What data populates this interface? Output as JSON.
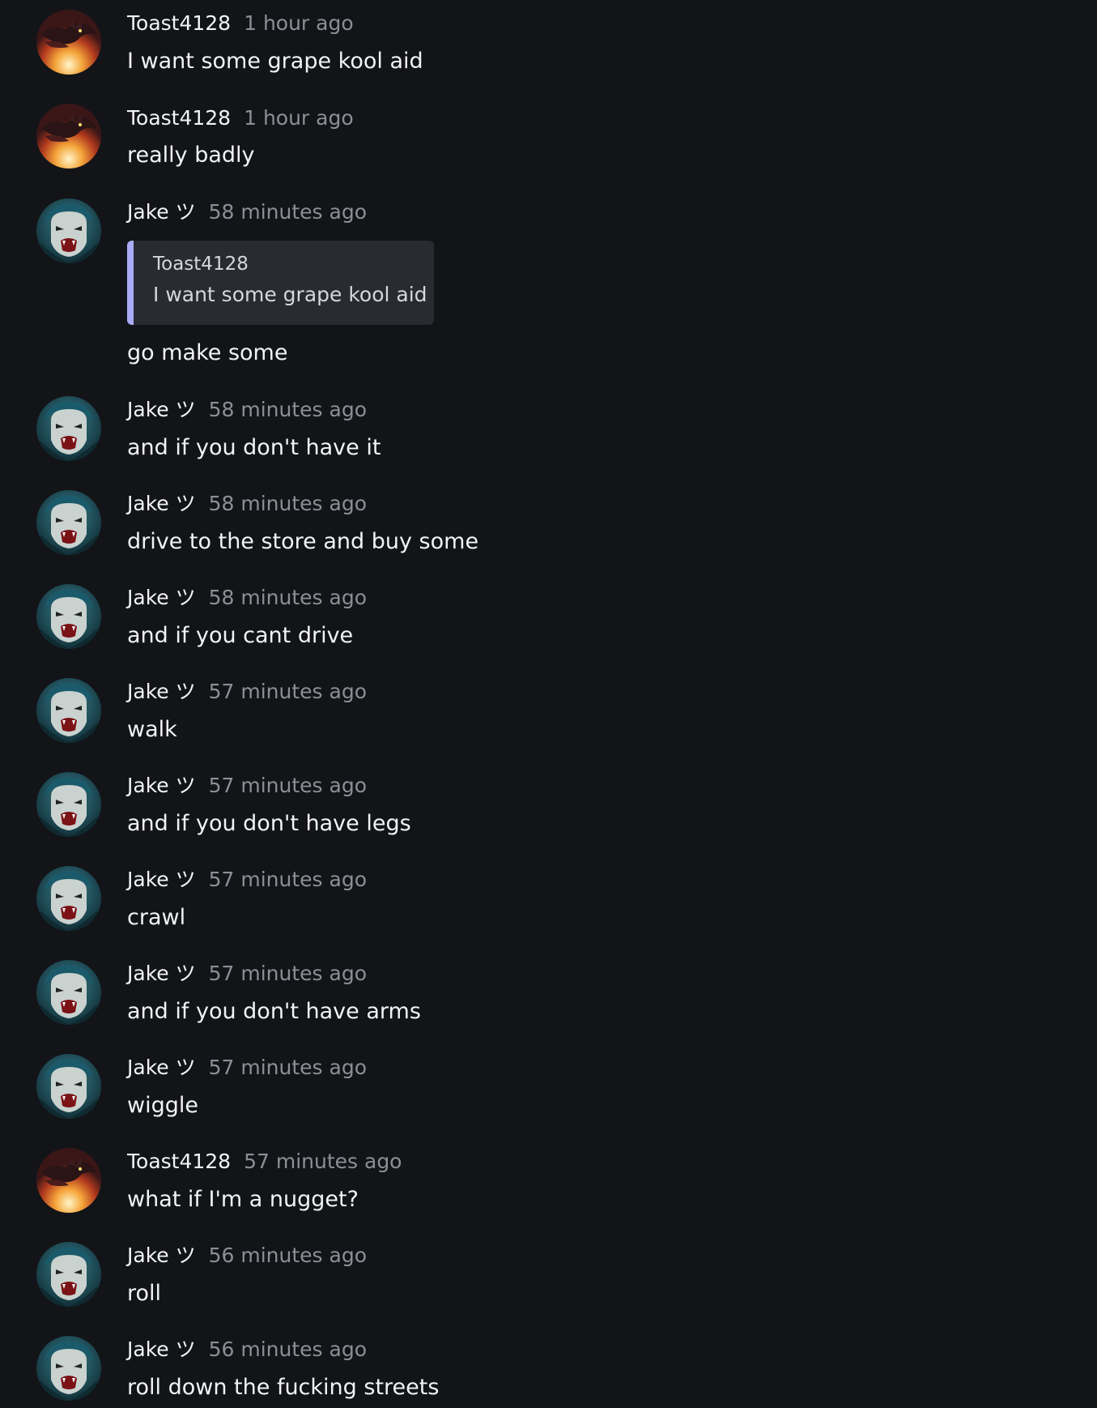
{
  "colors": {
    "background": "#131418",
    "text": "#f2f3f5",
    "timestamp": "#8d8f96",
    "quote_background": "#2a2b30",
    "quote_accent": "#a9abf5"
  },
  "users": {
    "toast": {
      "name": "Toast4128",
      "avatar": "dragon-flame-avatar"
    },
    "jake": {
      "name": "Jake ツ",
      "avatar": "vampire-face-avatar"
    }
  },
  "messages": [
    {
      "author": "Toast4128",
      "time": "1 hour ago",
      "text": "I want some grape kool aid"
    },
    {
      "author": "Toast4128",
      "time": "1 hour ago",
      "text": "really badly"
    },
    {
      "author": "Jake ツ",
      "time": "58 minutes ago",
      "quote": {
        "author": "Toast4128",
        "text": "I want some grape kool aid"
      },
      "text": "go make some"
    },
    {
      "author": "Jake ツ",
      "time": "58 minutes ago",
      "text": "and if you don't have it"
    },
    {
      "author": "Jake ツ",
      "time": "58 minutes ago",
      "text": "drive to the store and buy some"
    },
    {
      "author": "Jake ツ",
      "time": "58 minutes ago",
      "text": "and if you cant drive"
    },
    {
      "author": "Jake ツ",
      "time": "57 minutes ago",
      "text": "walk"
    },
    {
      "author": "Jake ツ",
      "time": "57 minutes ago",
      "text": "and if you don't have legs"
    },
    {
      "author": "Jake ツ",
      "time": "57 minutes ago",
      "text": "crawl"
    },
    {
      "author": "Jake ツ",
      "time": "57 minutes ago",
      "text": "and if you don't have arms"
    },
    {
      "author": "Jake ツ",
      "time": "57 minutes ago",
      "text": "wiggle"
    },
    {
      "author": "Toast4128",
      "time": "57 minutes ago",
      "text": "what if I'm a nugget?"
    },
    {
      "author": "Jake ツ",
      "time": "56 minutes ago",
      "text": "roll"
    },
    {
      "author": "Jake ツ",
      "time": "56 minutes ago",
      "text": "roll down the fucking streets"
    }
  ]
}
